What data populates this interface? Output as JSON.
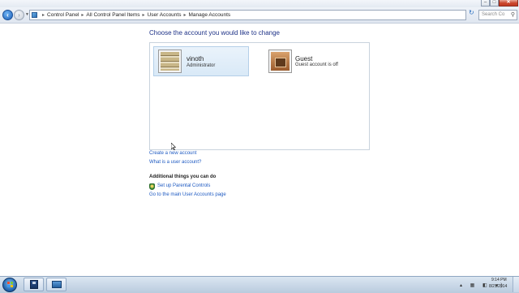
{
  "window": {
    "minimize_icon": "minimize-icon",
    "maximize_icon": "maximize-icon",
    "close_icon": "close-icon",
    "close_glyph": "✕",
    "minimize_glyph": "–",
    "maximize_glyph": "□"
  },
  "nav": {
    "back_glyph": "‹",
    "forward_glyph": "›",
    "breadcrumbs": [
      "Control Panel",
      "All Control Panel Items",
      "User Accounts",
      "Manage Accounts"
    ],
    "search_placeholder": "Search Co",
    "refresh_glyph": "↻"
  },
  "main": {
    "heading": "Choose the account you would like to change",
    "accounts": [
      {
        "name": "vinoth",
        "role": "Administrator",
        "picture": "stairs-picture"
      },
      {
        "name": "Guest",
        "role": "Guest account is off",
        "picture": "briefcase-picture"
      }
    ],
    "links": {
      "create": "Create a new account",
      "what": "What is a user account?"
    },
    "additional_title": "Additional things you can do",
    "parental_controls": "Set up Parental Controls",
    "main_page": "Go to the main User Accounts page"
  },
  "taskbar": {
    "clock_time": "9:14 PM",
    "clock_date": "8/21/2014"
  },
  "colors": {
    "heading": "#1e3287",
    "link": "#1e5ac2",
    "selected_tile": "#d9e9f7",
    "close_button": "#c9452c"
  }
}
